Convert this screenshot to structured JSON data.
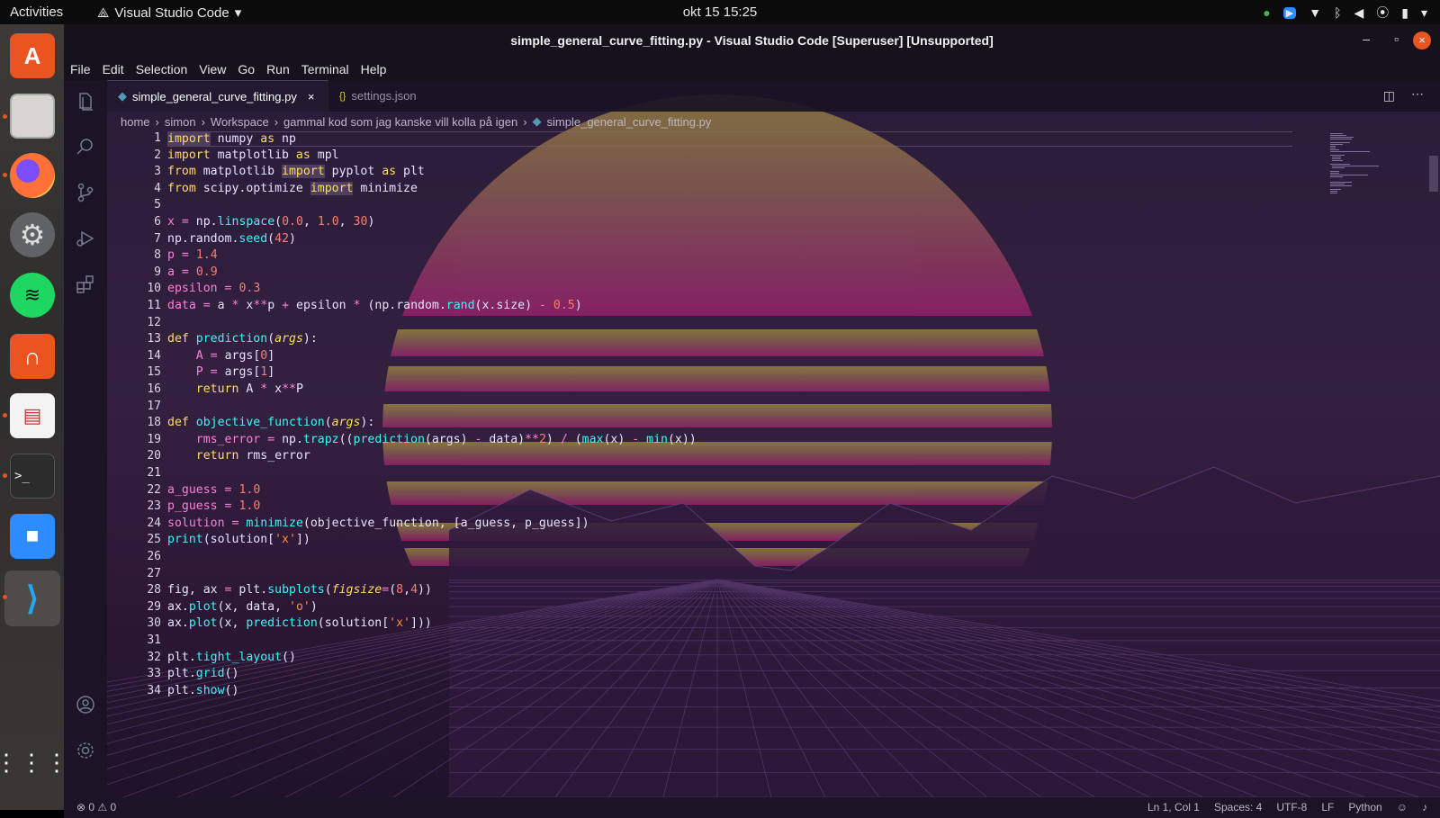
{
  "topbar": {
    "activities": "Activities",
    "app_menu": "Visual Studio Code",
    "clock": "okt 15  15:25"
  },
  "dock": {
    "items": [
      "ubuntu-software",
      "files",
      "firefox",
      "settings",
      "spotify",
      "headphones-app",
      "document-viewer",
      "terminal",
      "zoom",
      "vscode",
      "show-apps"
    ]
  },
  "window": {
    "title": "simple_general_curve_fitting.py - Visual Studio Code [Superuser] [Unsupported]"
  },
  "menu": [
    "File",
    "Edit",
    "Selection",
    "View",
    "Go",
    "Run",
    "Terminal",
    "Help"
  ],
  "tabs": [
    {
      "label": "simple_general_curve_fitting.py",
      "active": true,
      "close": "×"
    },
    {
      "label": "settings.json",
      "active": false,
      "icon_text": "{}"
    }
  ],
  "breadcrumb": [
    "home",
    "simon",
    "Workspace",
    "gammal kod som jag kanske vill kolla på igen",
    "simple_general_curve_fitting.py"
  ],
  "editor": {
    "line_numbers": [
      "1",
      "2",
      "3",
      "4",
      "5",
      "6",
      "7",
      "8",
      "9",
      "10",
      "11",
      "12",
      "13",
      "14",
      "15",
      "16",
      "17",
      "18",
      "19",
      "20",
      "21",
      "22",
      "23",
      "24",
      "25",
      "26",
      "27",
      "28",
      "29",
      "30",
      "31",
      "32",
      "33",
      "34"
    ]
  },
  "status": {
    "problems": "⊗ 0 ⚠ 0",
    "position": "Ln 1, Col 1",
    "spaces": "Spaces: 4",
    "encoding": "UTF-8",
    "eol": "LF",
    "language": "Python"
  },
  "colors": {
    "keyword": "#fede5d",
    "function": "#36f9f6",
    "variable": "#ff7edb",
    "number": "#f97e72",
    "string": "#ff8b39",
    "accent_close": "#e95420"
  }
}
